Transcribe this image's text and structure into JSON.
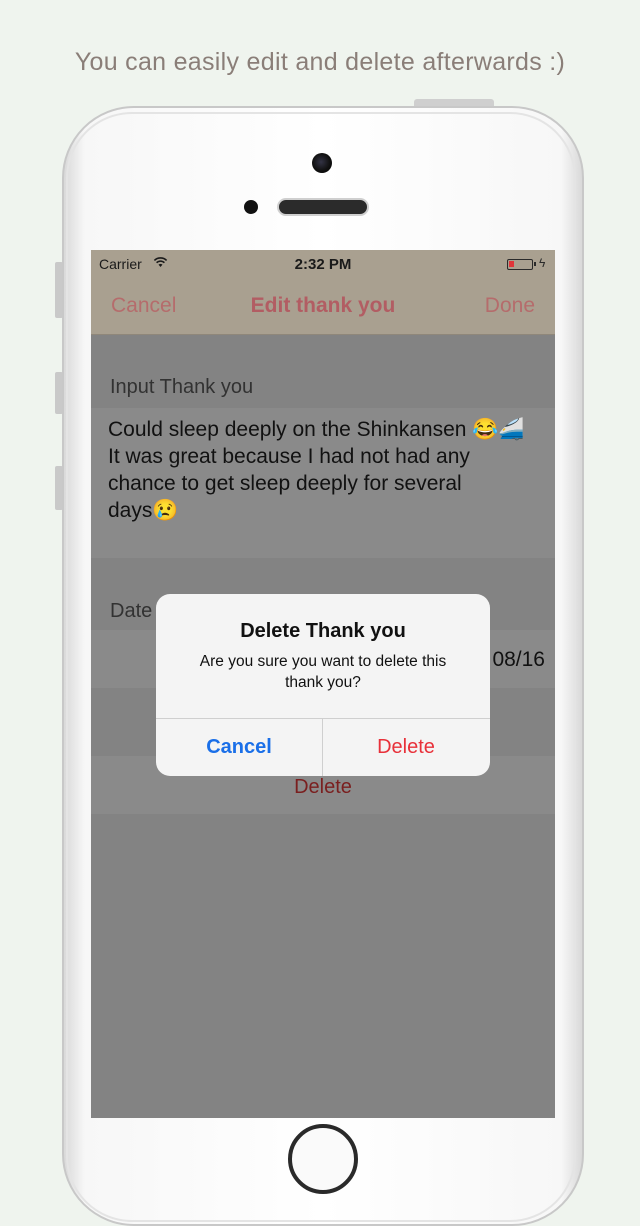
{
  "caption": "You can easily edit and delete afterwards :)",
  "status_bar": {
    "carrier": "Carrier",
    "time": "2:32 PM",
    "wifi_icon": "wifi-icon",
    "battery_icon": "battery-icon"
  },
  "navbar": {
    "cancel": "Cancel",
    "title": "Edit thank you",
    "done": "Done"
  },
  "form": {
    "input_label": "Input Thank you",
    "thank_you_text_line1": "Could sleep deeply on the Shinkansen 😂🚄",
    "thank_you_text_line2": "It was great because I had not had any",
    "thank_you_text_line3": "chance to get sleep deeply for several",
    "thank_you_text_line4": "days😢",
    "date_label": "Date",
    "date_value": "08/16",
    "delete_label": "Delete"
  },
  "alert": {
    "title": "Delete Thank you",
    "message": "Are you sure you want to delete this thank you?",
    "cancel": "Cancel",
    "delete": "Delete"
  },
  "colors": {
    "background": "#eff4ee",
    "navbar": "#a9a090",
    "nav_text": "#b25d63",
    "alert_cancel": "#1a6fe8",
    "alert_delete": "#e8313a",
    "overlay": "#838383"
  }
}
